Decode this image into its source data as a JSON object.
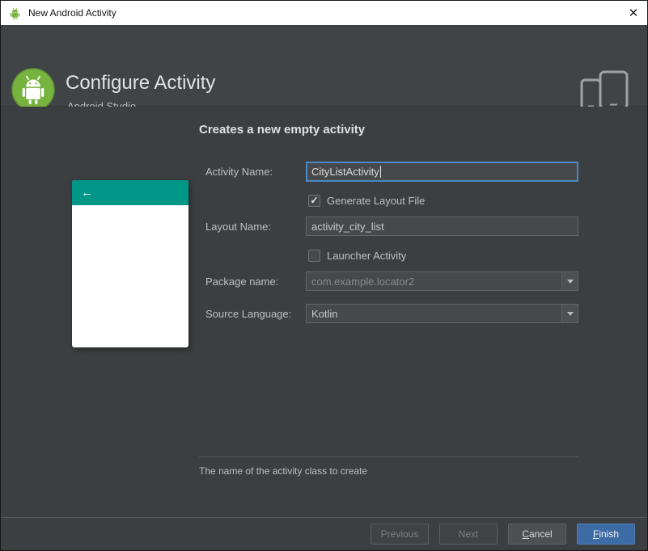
{
  "window": {
    "title": "New Android Activity"
  },
  "glyphs": {
    "close": "✕",
    "check": "✓",
    "back_arrow": "←"
  },
  "header": {
    "title": "Configure Activity",
    "subtitle": "Android Studio"
  },
  "content": {
    "heading": "Creates a new empty activity",
    "preview": {
      "appbar_color": "#009688"
    },
    "fields": {
      "activity_name": {
        "label": "Activity Name:",
        "value": "CityListActivity",
        "focused": true
      },
      "generate_layout": {
        "label": "Generate Layout File",
        "checked": true
      },
      "layout_name": {
        "label": "Layout Name:",
        "value": "activity_city_list"
      },
      "launcher_activity": {
        "label": "Launcher Activity",
        "checked": false
      },
      "package_name": {
        "label": "Package name:",
        "value": "com.example.locator2"
      },
      "source_language": {
        "label": "Source Language:",
        "value": "Kotlin"
      }
    },
    "help_text": "The name of the activity class to create"
  },
  "footer": {
    "previous": {
      "label": "Previous",
      "enabled": false
    },
    "next": {
      "label": "Next",
      "enabled": false
    },
    "cancel": {
      "mnemonic": "C",
      "rest": "ancel"
    },
    "finish": {
      "mnemonic": "F",
      "rest": "inish"
    }
  },
  "colors": {
    "preview_teal": "#009688",
    "focus_border": "#4a88c7",
    "finish_button": "#3c6ba5",
    "android_green": "#77b43f"
  }
}
